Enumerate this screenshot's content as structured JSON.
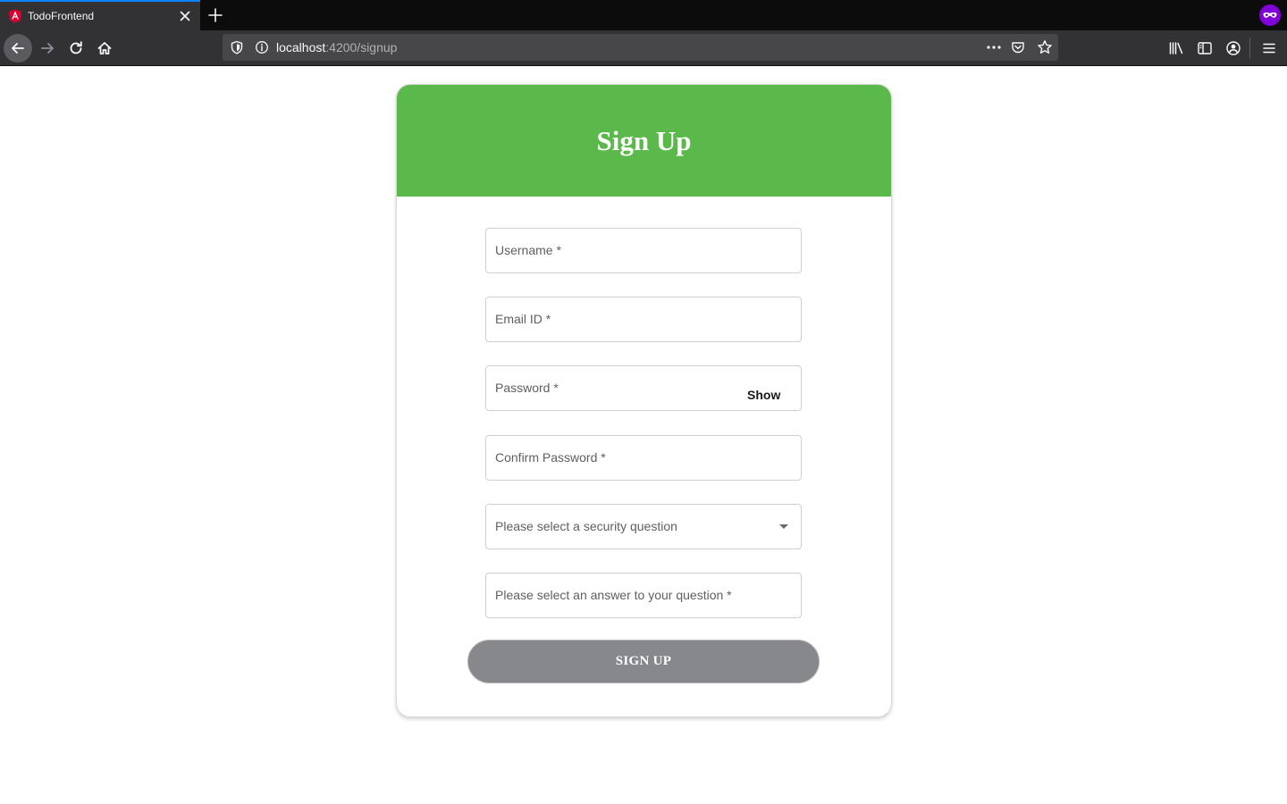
{
  "browser": {
    "tab_title": "TodoFrontend",
    "url_host": "localhost",
    "url_path": ":4200/signup"
  },
  "page": {
    "title": "Sign Up",
    "fields": {
      "username": "Username *",
      "email": "Email ID *",
      "password": "Password *",
      "password_toggle": "Show",
      "confirm_password": "Confirm Password *",
      "security_question": "Please select a security question",
      "security_answer": "Please select an answer to your question *"
    },
    "submit_label": "SIGN UP"
  },
  "colors": {
    "header": "#5bb84a",
    "submit_button": "#87888c",
    "tab_accent": "#0a84ff",
    "private_badge": "#8000d7"
  },
  "icons": [
    "angular-favicon-icon",
    "close-icon",
    "plus-icon",
    "private-browsing-icon",
    "back-arrow-icon",
    "forward-arrow-icon",
    "reload-icon",
    "home-icon",
    "shield-icon",
    "info-icon",
    "more-icon",
    "pocket-icon",
    "star-icon",
    "library-icon",
    "sidebar-icon",
    "account-icon",
    "hamburger-menu-icon",
    "chevron-down-icon"
  ]
}
